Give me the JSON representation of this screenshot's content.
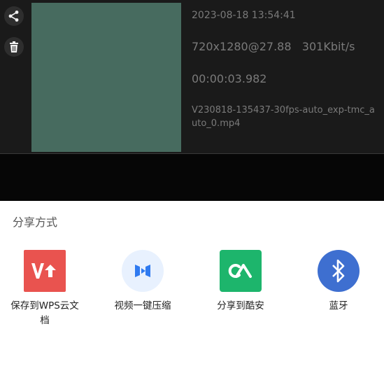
{
  "video": {
    "timestamp": "2023-08-18 13:54:41",
    "resolution": "720x1280@27.88   301Kbit/s",
    "duration": "00:00:03.982",
    "filename": "V230818-135437-30fps-auto_exp-tmc_auto_0.mp4",
    "thumbnail_color": "#476b5f"
  },
  "side_buttons": {
    "share_icon": "share-icon",
    "delete_icon": "trash-icon"
  },
  "sheet": {
    "title": "分享方式",
    "items": [
      {
        "label": "保存到WPS云文档",
        "icon": "wps-icon"
      },
      {
        "label": "视频一键压缩",
        "icon": "compress-icon"
      },
      {
        "label": "分享到酷安",
        "icon": "coolapk-icon"
      },
      {
        "label": "蓝牙",
        "icon": "bluetooth-icon"
      }
    ]
  },
  "colors": {
    "wps": "#e9534f",
    "compress_bg": "#e8f1fe",
    "compress_fg": "#2f7af0",
    "coolapk": "#1db56c",
    "bluetooth": "#3e6fd0"
  }
}
